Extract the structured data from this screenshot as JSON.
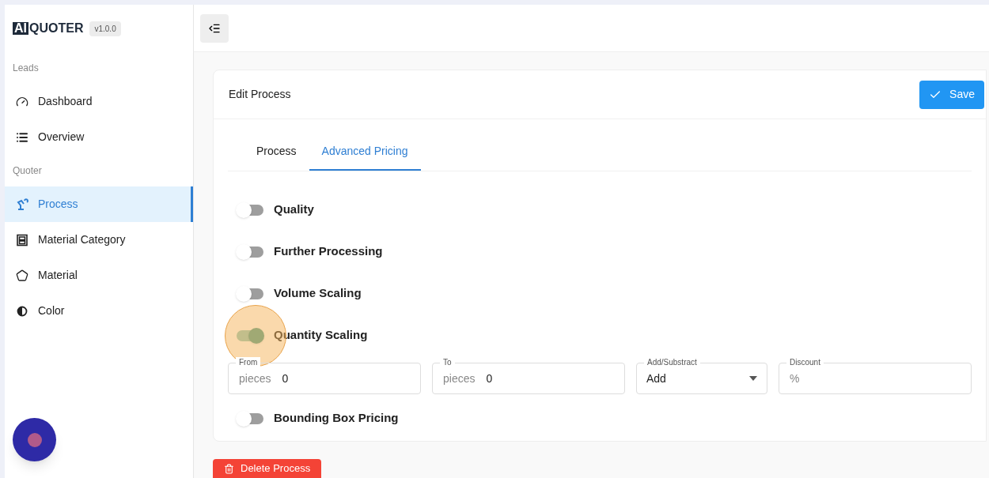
{
  "brand": {
    "logo_mark": "AI",
    "logo_text": "QUOTER",
    "version": "v1.0.0"
  },
  "sidebar": {
    "sections": [
      {
        "heading": "Leads",
        "items": [
          {
            "label": "Dashboard",
            "selected": false
          },
          {
            "label": "Overview",
            "selected": false
          }
        ]
      },
      {
        "heading": "Quoter",
        "items": [
          {
            "label": "Process",
            "selected": true
          },
          {
            "label": "Material Category",
            "selected": false
          },
          {
            "label": "Material",
            "selected": false
          },
          {
            "label": "Color",
            "selected": false
          }
        ]
      }
    ]
  },
  "card": {
    "title": "Edit Process",
    "save_button": "Save",
    "tabs": [
      {
        "label": "Process",
        "selected": false
      },
      {
        "label": "Advanced Pricing",
        "selected": true
      }
    ],
    "options": [
      {
        "label": "Quality",
        "on": false
      },
      {
        "label": "Further Processing",
        "on": false
      },
      {
        "label": "Volume Scaling",
        "on": false
      },
      {
        "label": "Quantity Scaling",
        "on": true,
        "fields": [
          {
            "kind": "text",
            "label": "From",
            "prefix": "pieces",
            "value": "0"
          },
          {
            "kind": "text",
            "label": "To",
            "prefix": "pieces",
            "value": "0"
          },
          {
            "kind": "select",
            "label": "Add/Substract",
            "value": "Add"
          },
          {
            "kind": "text",
            "label": "Discount",
            "prefix": "%"
          }
        ]
      },
      {
        "label": "Bounding Box Pricing",
        "on": false
      }
    ]
  },
  "delete_button": "Delete Process"
}
